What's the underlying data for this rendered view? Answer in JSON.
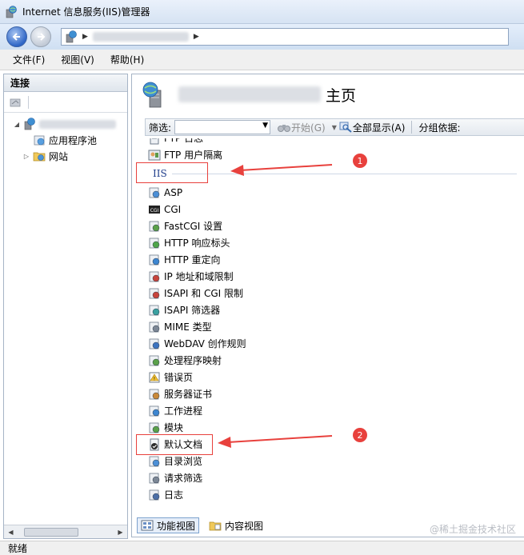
{
  "window": {
    "title": "Internet 信息服务(IIS)管理器"
  },
  "menu": [
    "文件(F)",
    "视图(V)",
    "帮助(H)"
  ],
  "left_pane": {
    "header": "连接",
    "tree": [
      {
        "label": "应用程序池"
      },
      {
        "label": "网站"
      }
    ]
  },
  "page": {
    "title": "主页"
  },
  "filter_bar": {
    "label": "筛选:",
    "start": "开始(G)",
    "show_all": "全部显示(A)",
    "group_by": "分组依据:"
  },
  "features_top": [
    {
      "label": "FTP 日志",
      "icon": "log-icon"
    },
    {
      "label": "FTP 用户隔离",
      "icon": "isolation-icon"
    }
  ],
  "group": {
    "label": "IIS"
  },
  "features": [
    {
      "label": "ASP",
      "icon": "asp-icon"
    },
    {
      "label": "CGI",
      "icon": "cgi-icon"
    },
    {
      "label": "FastCGI 设置",
      "icon": "fastcgi-icon"
    },
    {
      "label": "HTTP 响应标头",
      "icon": "http-headers-icon"
    },
    {
      "label": "HTTP 重定向",
      "icon": "http-redirect-icon"
    },
    {
      "label": "IP 地址和域限制",
      "icon": "ip-restrictions-icon"
    },
    {
      "label": "ISAPI 和 CGI 限制",
      "icon": "isapi-cgi-icon"
    },
    {
      "label": "ISAPI 筛选器",
      "icon": "isapi-filter-icon"
    },
    {
      "label": "MIME 类型",
      "icon": "mime-icon"
    },
    {
      "label": "WebDAV 创作规则",
      "icon": "webdav-icon"
    },
    {
      "label": "处理程序映射",
      "icon": "handler-mapping-icon"
    },
    {
      "label": "错误页",
      "icon": "error-page-icon"
    },
    {
      "label": "服务器证书",
      "icon": "certificate-icon"
    },
    {
      "label": "工作进程",
      "icon": "worker-process-icon"
    },
    {
      "label": "模块",
      "icon": "module-icon"
    },
    {
      "label": "默认文档",
      "icon": "default-document-icon"
    },
    {
      "label": "目录浏览",
      "icon": "directory-browsing-icon"
    },
    {
      "label": "请求筛选",
      "icon": "request-filtering-icon"
    },
    {
      "label": "日志",
      "icon": "logging-icon"
    }
  ],
  "bottom_tabs": [
    "功能视图",
    "内容视图"
  ],
  "status": "就绪",
  "annotations": {
    "badge1": "1",
    "badge2": "2"
  },
  "watermark": "@稀土掘金技术社区",
  "colors": {
    "accent_red": "#e8413d",
    "group_blue": "#1e3c8a"
  }
}
